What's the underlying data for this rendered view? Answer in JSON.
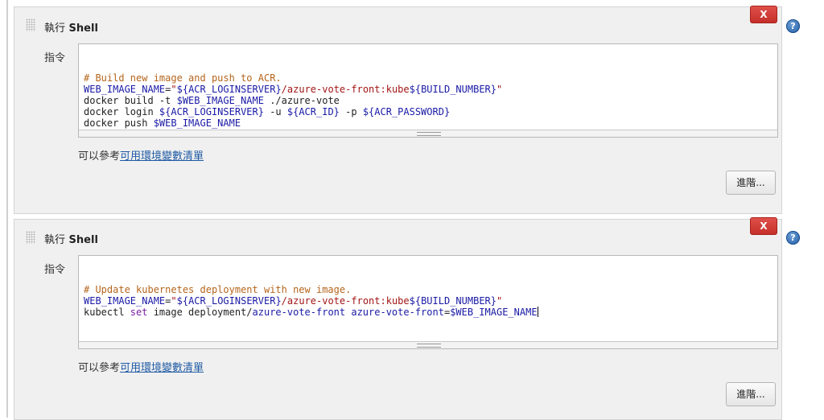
{
  "steps": [
    {
      "title_cjk": "執行",
      "title_en": "Shell",
      "delete_label": "X",
      "help_label": "?",
      "command_label": "指令",
      "code_lines": [
        [
          {
            "t": "comment",
            "v": "# Build new image and push to ACR."
          }
        ],
        [
          {
            "t": "var",
            "v": "WEB_IMAGE_NAME"
          },
          {
            "t": "plain",
            "v": "="
          },
          {
            "t": "str",
            "v": "\""
          },
          {
            "t": "var",
            "v": "${ACR_LOGINSERVER}"
          },
          {
            "t": "str",
            "v": "/azure-vote-front:kube"
          },
          {
            "t": "var",
            "v": "${BUILD_NUMBER}"
          },
          {
            "t": "str",
            "v": "\""
          }
        ],
        [
          {
            "t": "plain",
            "v": "docker build -t "
          },
          {
            "t": "var",
            "v": "$WEB_IMAGE_NAME"
          },
          {
            "t": "plain",
            "v": " ./azure-vote"
          }
        ],
        [
          {
            "t": "plain",
            "v": "docker login "
          },
          {
            "t": "var",
            "v": "${ACR_LOGINSERVER}"
          },
          {
            "t": "plain",
            "v": " -u "
          },
          {
            "t": "var",
            "v": "${ACR_ID}"
          },
          {
            "t": "plain",
            "v": " -p "
          },
          {
            "t": "var",
            "v": "${ACR_PASSWORD}"
          }
        ],
        [
          {
            "t": "plain",
            "v": "docker push "
          },
          {
            "t": "var",
            "v": "$WEB_IMAGE_NAME"
          }
        ]
      ],
      "help_prefix": "可以參考",
      "help_link": "可用環境變數清單",
      "advanced_label": "進階..."
    },
    {
      "title_cjk": "執行",
      "title_en": "Shell",
      "delete_label": "X",
      "help_label": "?",
      "command_label": "指令",
      "code_lines": [
        [
          {
            "t": "comment",
            "v": "# Update kubernetes deployment with new image."
          }
        ],
        [
          {
            "t": "var",
            "v": "WEB_IMAGE_NAME"
          },
          {
            "t": "plain",
            "v": "="
          },
          {
            "t": "str",
            "v": "\""
          },
          {
            "t": "var",
            "v": "${ACR_LOGINSERVER}"
          },
          {
            "t": "str",
            "v": "/azure-vote-front:kube"
          },
          {
            "t": "var",
            "v": "${BUILD_NUMBER}"
          },
          {
            "t": "str",
            "v": "\""
          }
        ],
        [
          {
            "t": "plain",
            "v": "kubectl "
          },
          {
            "t": "kw",
            "v": "set"
          },
          {
            "t": "plain",
            "v": " image deployment/"
          },
          {
            "t": "str-blue",
            "v": "azure-vote-front"
          },
          {
            "t": "plain",
            "v": " "
          },
          {
            "t": "str-blue",
            "v": "azure-vote-front"
          },
          {
            "t": "plain",
            "v": "="
          },
          {
            "t": "var",
            "v": "$WEB_IMAGE_NAME"
          },
          {
            "t": "cursor",
            "v": ""
          }
        ]
      ],
      "help_prefix": "可以參考",
      "help_link": "可用環境變數清單",
      "advanced_label": "進階..."
    }
  ]
}
